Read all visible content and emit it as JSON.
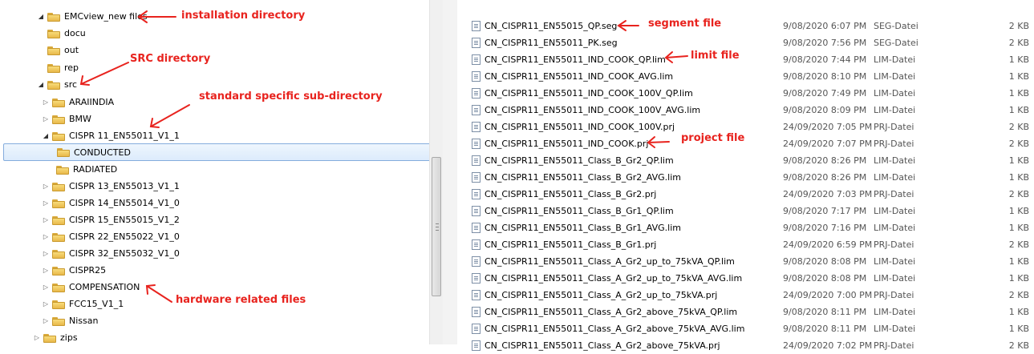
{
  "tree": {
    "items": [
      {
        "label": "EMCview_new files",
        "expander": "expanded"
      },
      {
        "label": "docu",
        "expander": "none"
      },
      {
        "label": "out",
        "expander": "none"
      },
      {
        "label": "rep",
        "expander": "none"
      },
      {
        "label": "src",
        "expander": "expanded"
      },
      {
        "label": "ARAIINDIA",
        "expander": "collapsed"
      },
      {
        "label": "BMW",
        "expander": "collapsed"
      },
      {
        "label": "CISPR 11_EN55011_V1_1",
        "expander": "expanded"
      },
      {
        "label": "CONDUCTED",
        "expander": "none",
        "selected": true
      },
      {
        "label": "RADIATED",
        "expander": "none"
      },
      {
        "label": "CISPR 13_EN55013_V1_1",
        "expander": "collapsed"
      },
      {
        "label": "CISPR 14_EN55014_V1_0",
        "expander": "collapsed"
      },
      {
        "label": "CISPR 15_EN55015_V1_2",
        "expander": "collapsed"
      },
      {
        "label": "CISPR 22_EN55022_V1_0",
        "expander": "collapsed"
      },
      {
        "label": "CISPR 32_EN55032_V1_0",
        "expander": "collapsed"
      },
      {
        "label": "CISPR25",
        "expander": "collapsed"
      },
      {
        "label": "COMPENSATION",
        "expander": "collapsed"
      },
      {
        "label": "FCC15_V1_1",
        "expander": "collapsed"
      },
      {
        "label": "Nissan",
        "expander": "collapsed"
      },
      {
        "label": "zips",
        "expander": "collapsed"
      }
    ]
  },
  "files": [
    {
      "name": "CN_CISPR11_EN55015_QP.seg",
      "date": "9/08/2020 6:07 PM",
      "type": "SEG-Datei",
      "size": "2 KB"
    },
    {
      "name": "CN_CISPR11_EN55011_PK.seg",
      "date": "9/08/2020 7:56 PM",
      "type": "SEG-Datei",
      "size": "2 KB"
    },
    {
      "name": "CN_CISPR11_EN55011_IND_COOK_QP.lim",
      "date": "9/08/2020 7:44 PM",
      "type": "LIM-Datei",
      "size": "1 KB"
    },
    {
      "name": "CN_CISPR11_EN55011_IND_COOK_AVG.lim",
      "date": "9/08/2020 8:10 PM",
      "type": "LIM-Datei",
      "size": "1 KB"
    },
    {
      "name": "CN_CISPR11_EN55011_IND_COOK_100V_QP.lim",
      "date": "9/08/2020 7:49 PM",
      "type": "LIM-Datei",
      "size": "1 KB"
    },
    {
      "name": "CN_CISPR11_EN55011_IND_COOK_100V_AVG.lim",
      "date": "9/08/2020 8:09 PM",
      "type": "LIM-Datei",
      "size": "1 KB"
    },
    {
      "name": "CN_CISPR11_EN55011_IND_COOK_100V.prj",
      "date": "24/09/2020 7:05 PM",
      "type": "PRJ-Datei",
      "size": "2 KB"
    },
    {
      "name": "CN_CISPR11_EN55011_IND_COOK.prj",
      "date": "24/09/2020 7:07 PM",
      "type": "PRJ-Datei",
      "size": "2 KB"
    },
    {
      "name": "CN_CISPR11_EN55011_Class_B_Gr2_QP.lim",
      "date": "9/08/2020 8:26 PM",
      "type": "LIM-Datei",
      "size": "1 KB"
    },
    {
      "name": "CN_CISPR11_EN55011_Class_B_Gr2_AVG.lim",
      "date": "9/08/2020 8:26 PM",
      "type": "LIM-Datei",
      "size": "1 KB"
    },
    {
      "name": "CN_CISPR11_EN55011_Class_B_Gr2.prj",
      "date": "24/09/2020 7:03 PM",
      "type": "PRJ-Datei",
      "size": "2 KB"
    },
    {
      "name": "CN_CISPR11_EN55011_Class_B_Gr1_QP.lim",
      "date": "9/08/2020 7:17 PM",
      "type": "LIM-Datei",
      "size": "1 KB"
    },
    {
      "name": "CN_CISPR11_EN55011_Class_B_Gr1_AVG.lim",
      "date": "9/08/2020 7:16 PM",
      "type": "LIM-Datei",
      "size": "1 KB"
    },
    {
      "name": "CN_CISPR11_EN55011_Class_B_Gr1.prj",
      "date": "24/09/2020 6:59 PM",
      "type": "PRJ-Datei",
      "size": "2 KB"
    },
    {
      "name": "CN_CISPR11_EN55011_Class_A_Gr2_up_to_75kVA_QP.lim",
      "date": "9/08/2020 8:08 PM",
      "type": "LIM-Datei",
      "size": "1 KB"
    },
    {
      "name": "CN_CISPR11_EN55011_Class_A_Gr2_up_to_75kVA_AVG.lim",
      "date": "9/08/2020 8:08 PM",
      "type": "LIM-Datei",
      "size": "1 KB"
    },
    {
      "name": "CN_CISPR11_EN55011_Class_A_Gr2_up_to_75kVA.prj",
      "date": "24/09/2020 7:00 PM",
      "type": "PRJ-Datei",
      "size": "2 KB"
    },
    {
      "name": "CN_CISPR11_EN55011_Class_A_Gr2_above_75kVA_QP.lim",
      "date": "9/08/2020 8:11 PM",
      "type": "LIM-Datei",
      "size": "1 KB"
    },
    {
      "name": "CN_CISPR11_EN55011_Class_A_Gr2_above_75kVA_AVG.lim",
      "date": "9/08/2020 8:11 PM",
      "type": "LIM-Datei",
      "size": "1 KB"
    },
    {
      "name": "CN_CISPR11_EN55011_Class_A_Gr2_above_75kVA.prj",
      "date": "24/09/2020 7:02 PM",
      "type": "PRJ-Datei",
      "size": "2 KB"
    }
  ],
  "annotations": {
    "installation_directory": "installation directory",
    "src_directory": "SRC directory",
    "standard_specific": "standard specific sub-directory",
    "hardware_related": "hardware related files",
    "segment_file": "segment file",
    "limit_file": "limit file",
    "project_file": "project file",
    "color": "#e8231e"
  },
  "icons": {
    "expanded": "triangle-down-right",
    "collapsed": "triangle-right",
    "folder": "folder-icon",
    "file": "file-icon"
  }
}
